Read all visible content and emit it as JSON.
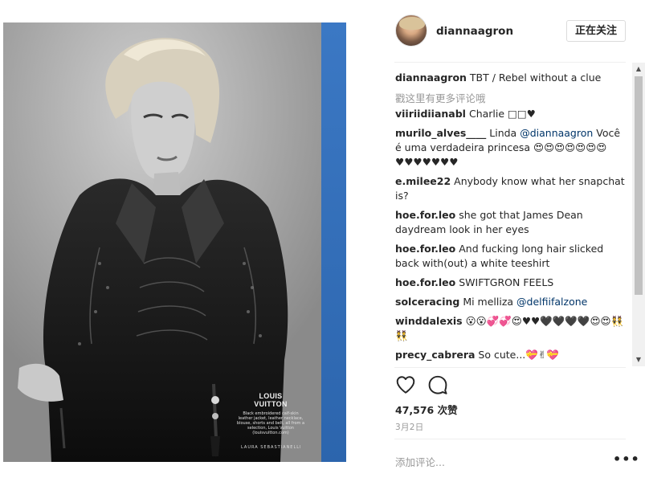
{
  "post": {
    "author": "diannaagron",
    "follow_label": "正在关注",
    "photo_caption": {
      "title_line1": "LOUIS",
      "title_line2": "VUITTON",
      "body": "Black embroidered calf-skin leather jacket, leather necklace, blouse, shorts and belt, all from a selection, Louis Vuitton (louisvuitton.com)",
      "credit": "LAURA SEBASTIANELLI"
    }
  },
  "caption": {
    "user": "diannaagron",
    "text": "TBT / Rebel without a clue"
  },
  "load_more_label": "戳这里有更多评论哦",
  "comments": [
    {
      "user": "viiriidiianabl",
      "text": "Charlie □□♥"
    },
    {
      "user": "murilo_alves____",
      "text": "Linda ",
      "mention": "@diannaagron",
      "text2": " Você é uma verdadeira princesa 😍😍😍😍😍😍😍♥♥♥♥♥♥♥"
    },
    {
      "user": "e.milee22",
      "text": "Anybody know what her snapchat is?"
    },
    {
      "user": "hoe.for.leo",
      "text": "she got that James Dean daydream look in her eyes"
    },
    {
      "user": "hoe.for.leo",
      "text": "And fucking long hair slicked back with(out) a white teeshirt"
    },
    {
      "user": "hoe.for.leo",
      "text": "SWIFTGRON FEELS"
    },
    {
      "user": "solceracing",
      "text": "Mi melliza ",
      "mention": "@delfiifalzone"
    },
    {
      "user": "winddalexis",
      "text": "😮😮💞💞😍♥♥🖤🖤🖤🖤😍😍👯👯"
    },
    {
      "user": "precy_cabrera",
      "text": "So cute...💝✌💝"
    }
  ],
  "likes_label": "47,576 次赞",
  "date_label": "3月2日",
  "add_comment_placeholder": "添加评论...",
  "more_label": "•••",
  "icons": {
    "like": "heart-icon",
    "comment": "comment-bubble-icon",
    "scroll_up": "triangle-up-icon",
    "scroll_down": "triangle-down-icon"
  },
  "colors": {
    "text": "#262626",
    "muted": "#999999",
    "mention": "#003569",
    "border": "#dbdbdb",
    "photo_edge_blue": "#2d6bb3"
  }
}
